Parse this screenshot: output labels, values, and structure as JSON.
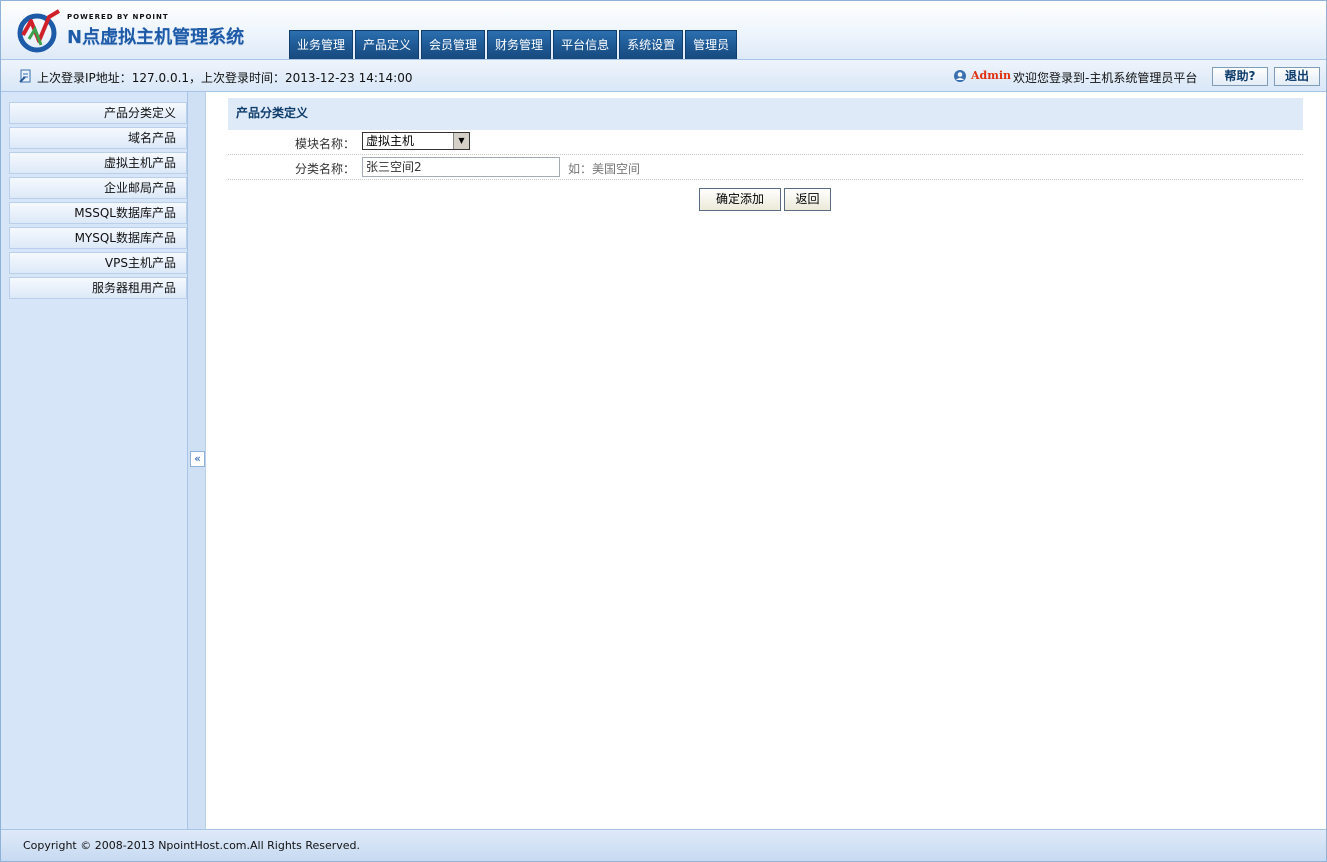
{
  "header": {
    "logo_powered": "POWERED BY NPOINT",
    "logo_name": "N点虚拟主机管理系统",
    "nav_tabs": [
      "业务管理",
      "产品定义",
      "会员管理",
      "财务管理",
      "平台信息",
      "系统设置",
      "管理员"
    ]
  },
  "infobar": {
    "last_login": "上次登录IP地址：127.0.0.1，上次登录时间：2013-12-23 14:14:00",
    "admin_name": "Admin",
    "welcome": "欢迎您登录到-主机系统管理员平台",
    "help_label": "帮助?",
    "logout_label": "退出"
  },
  "sidebar": {
    "items": [
      "产品分类定义",
      "域名产品",
      "虚拟主机产品",
      "企业邮局产品",
      "MSSQL数据库产品",
      "MYSQL数据库产品",
      "VPS主机产品",
      "服务器租用产品"
    ],
    "collapse_label": "«"
  },
  "main": {
    "panel_title": "产品分类定义",
    "module_label": "模块名称：",
    "module_value": "虚拟主机",
    "category_label": "分类名称：",
    "category_value": "张三空间2",
    "category_hint": "如：美国空间",
    "confirm_label": "确定添加",
    "back_label": "返回"
  },
  "footer": {
    "copyright": "Copyright © 2008-2013 NpointHost.com.All Rights Reserved."
  },
  "colors": {
    "nav_tab_bg": "#1f5a95",
    "admin_name": "#e03010",
    "panel_title_bg": "#dfeaf8",
    "sidebar_bg": "#d6e5f7"
  }
}
